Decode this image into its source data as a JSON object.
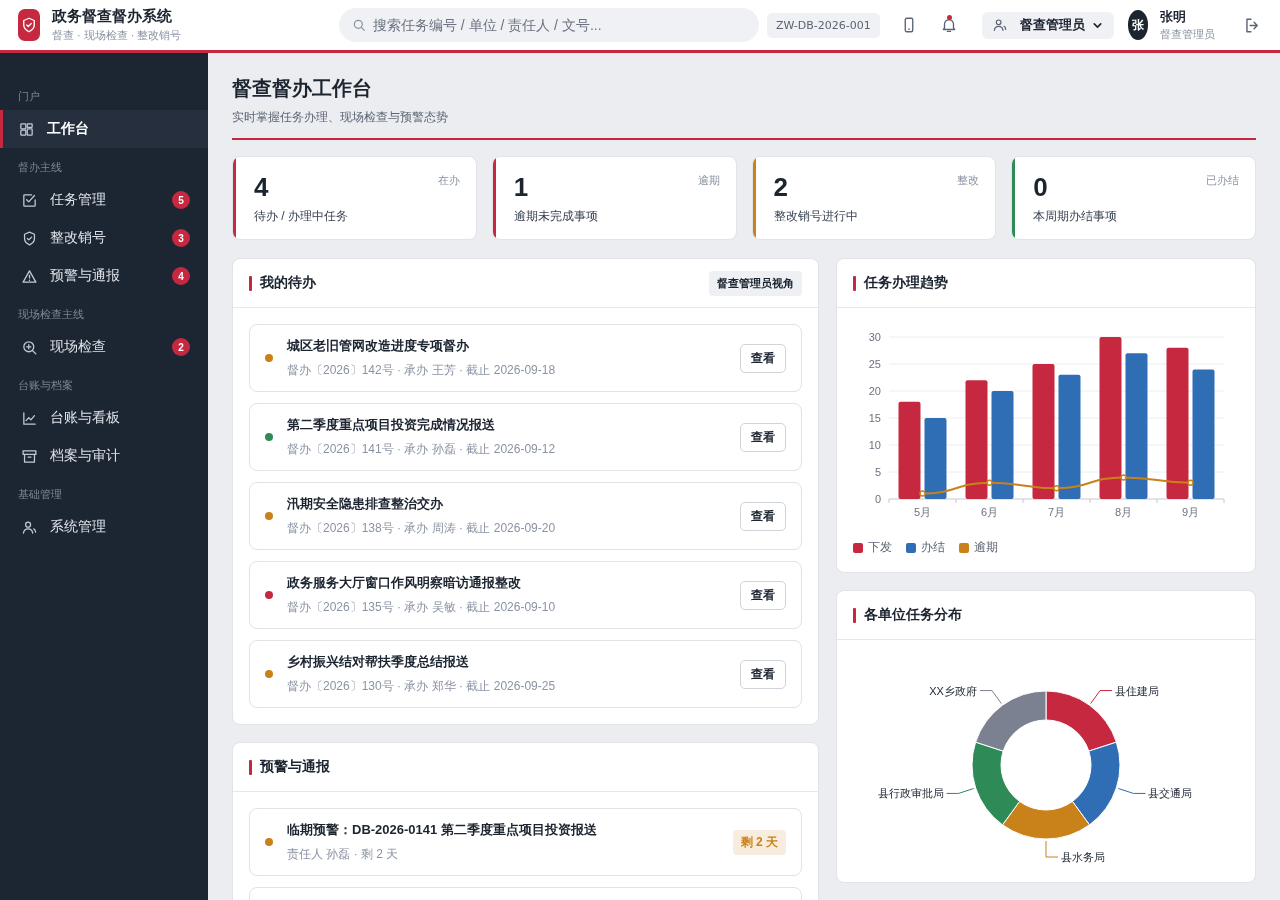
{
  "header": {
    "app_title": "政务督查督办系统",
    "app_subtitle": "督查 · 现场检查 · 整改销号",
    "search": {
      "placeholder": "搜索任务编号 / 单位 / 责任人 / 文号..."
    },
    "code_chip": "ZW-DB-2026-001",
    "bell_unread": true,
    "role_select": "督查管理员",
    "avatar": "张",
    "user_name": "张明",
    "user_role": "督查管理员"
  },
  "sidebar": {
    "groups": [
      {
        "label": "门户",
        "items": [
          {
            "label": "工作台",
            "selected": true
          }
        ]
      },
      {
        "label": "督办主线",
        "items": [
          {
            "label": "任务管理",
            "badge": "5",
            "selected": false
          },
          {
            "label": "整改销号",
            "badge": "3",
            "selected": false
          },
          {
            "label": "预警与通报",
            "badge": "4",
            "selected": false
          }
        ]
      },
      {
        "label": "现场检查主线",
        "items": [
          {
            "label": "现场检查",
            "badge": "2",
            "selected": false
          }
        ]
      },
      {
        "label": "台账与档案",
        "items": [
          {
            "label": "台账与看板",
            "selected": false
          },
          {
            "label": "档案与审计",
            "selected": false
          }
        ]
      },
      {
        "label": "基础管理",
        "items": [
          {
            "label": "系统管理",
            "selected": false
          }
        ]
      }
    ]
  },
  "page": {
    "title": "督查督办工作台",
    "subtitle": "实时掌握任务办理、现场检查与预警态势"
  },
  "stats": [
    {
      "value": "4",
      "tag": "在办",
      "label": "待办 / 办理中任务",
      "color": "#c62840"
    },
    {
      "value": "1",
      "tag": "逾期",
      "label": "逾期未完成事项",
      "color": "#c62840"
    },
    {
      "value": "2",
      "tag": "整改",
      "label": "整改销号进行中",
      "color": "#c98119"
    },
    {
      "value": "0",
      "tag": "已办结",
      "label": "本周期办结事项",
      "color": "#2e8b57"
    }
  ],
  "todo": {
    "title": "我的待办",
    "badge": "督查管理员视角",
    "items": [
      {
        "title": "城区老旧管网改造进度专项督办",
        "meta": "督办〔2026〕142号 · 承办 王芳 · 截止 2026-09-18",
        "color": "#c98119",
        "action": "查看"
      },
      {
        "title": "第二季度重点项目投资完成情况报送",
        "meta": "督办〔2026〕141号 · 承办 孙磊 · 截止 2026-09-12",
        "color": "#2e8b57",
        "action": "查看"
      },
      {
        "title": "汛期安全隐患排查整治交办",
        "meta": "督办〔2026〕138号 · 承办 周涛 · 截止 2026-09-20",
        "color": "#c98119",
        "action": "查看"
      },
      {
        "title": "政务服务大厅窗口作风明察暗访通报整改",
        "meta": "督办〔2026〕135号 · 承办 吴敏 · 截止 2026-09-10",
        "color": "#c62840",
        "action": "查看"
      },
      {
        "title": "乡村振兴结对帮扶季度总结报送",
        "meta": "督办〔2026〕130号 · 承办 郑华 · 截止 2026-09-25",
        "color": "#c98119",
        "action": "查看"
      }
    ]
  },
  "alerts": {
    "title": "预警与通报",
    "items": [
      {
        "title": "临期预警：DB-2026-0141 第二季度重点项目投资报送",
        "meta": "责任人 孙磊 · 剩 2 天",
        "tag": "剩 2 天",
        "color": "#c98119"
      }
    ]
  },
  "trend": {
    "title": "任务办理趋势",
    "chart_data": {
      "type": "bar",
      "categories": [
        "5月",
        "6月",
        "7月",
        "8月",
        "9月"
      ],
      "ylim": [
        0,
        30
      ],
      "grid": true,
      "legend": true,
      "yticks": [
        0,
        5,
        10,
        15,
        20,
        25,
        30
      ],
      "series": [
        {
          "name": "下发",
          "color": "#c62840",
          "values": [
            18,
            22,
            25,
            30,
            28
          ]
        },
        {
          "name": "办结",
          "color": "#2f6eb5",
          "values": [
            15,
            20,
            23,
            27,
            24
          ]
        },
        {
          "name": "逾期",
          "color": "#c98119",
          "values": [
            1,
            3,
            2,
            4,
            3
          ],
          "type": "line",
          "marker": true
        }
      ]
    }
  },
  "distribution": {
    "title": "各单位任务分布",
    "chart_data": {
      "type": "donut",
      "categories": [
        "县住建局",
        "县交通局",
        "县水务局",
        "县行政审批局",
        "XX乡政府"
      ],
      "series": [
        {
          "values": [
            20,
            20,
            20,
            20,
            20
          ]
        }
      ],
      "colors": [
        "#c62840",
        "#2f6eb5",
        "#c98119",
        "#2e8b57",
        "#7b8190"
      ]
    }
  }
}
